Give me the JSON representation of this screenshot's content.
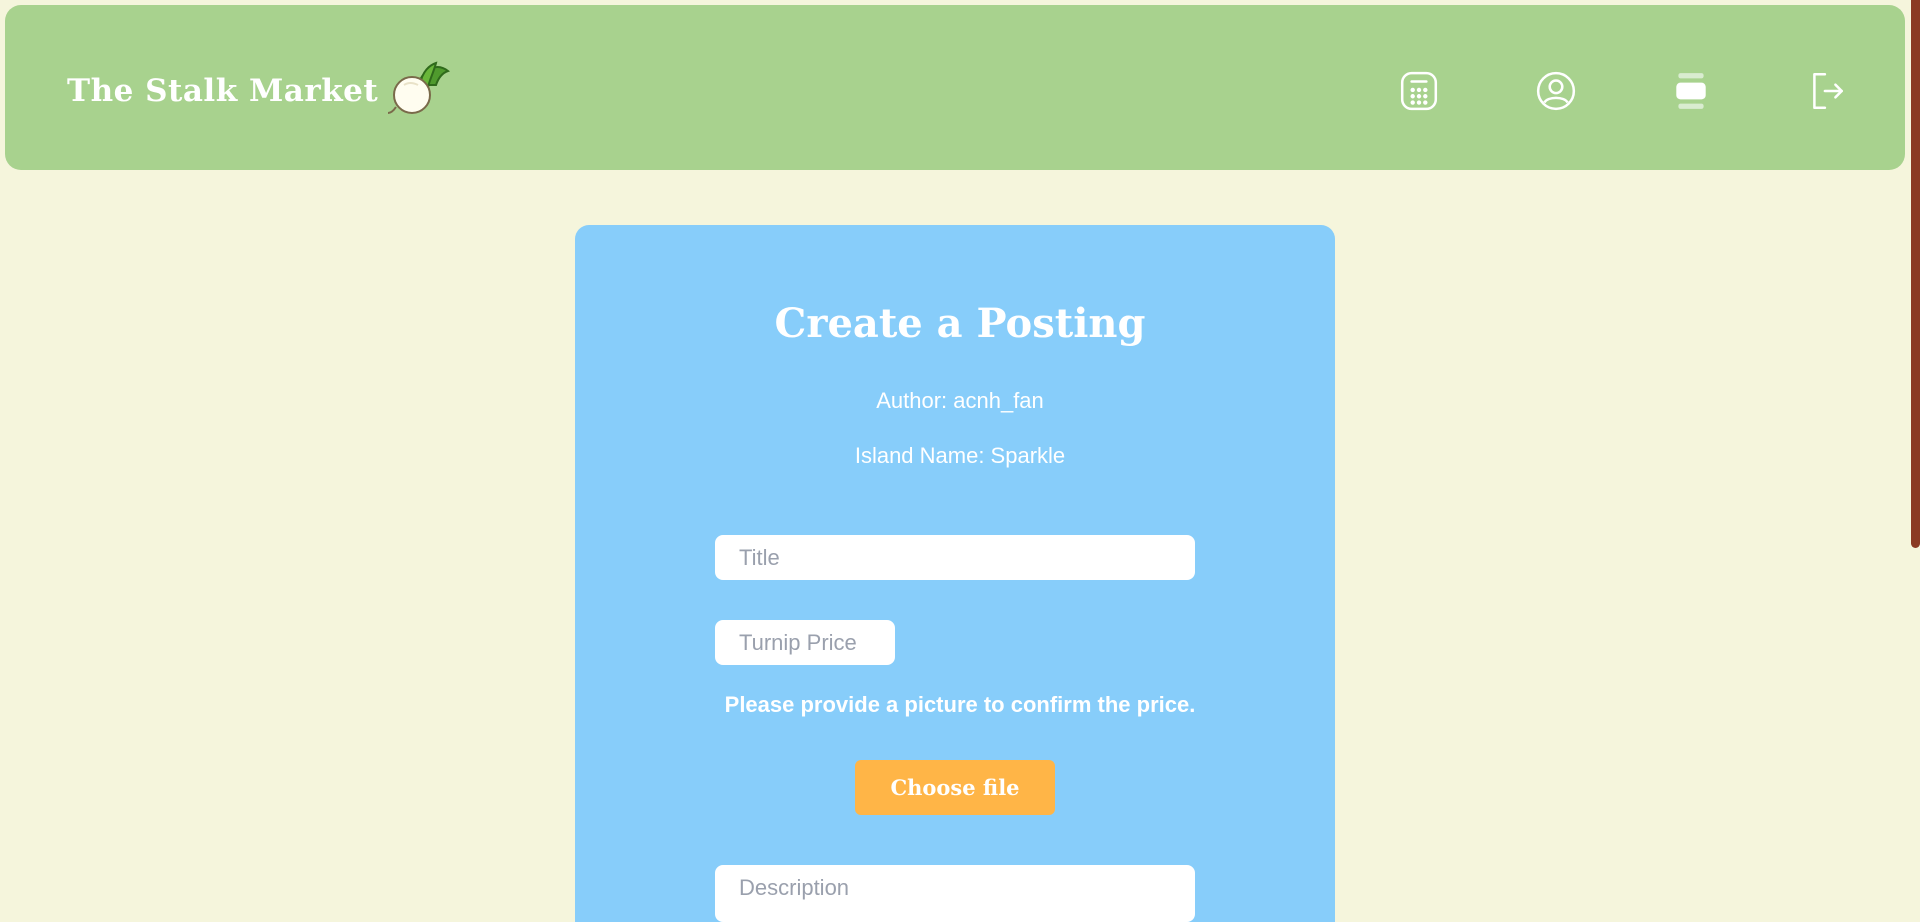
{
  "header": {
    "brand": "The Stalk Market",
    "nav": [
      {
        "icon": "calculator-icon",
        "label": ""
      },
      {
        "icon": "profile-icon",
        "label": ""
      },
      {
        "icon": "postings-icon",
        "label": ""
      },
      {
        "icon": "logout-icon",
        "label": ""
      }
    ]
  },
  "form": {
    "title": "Create a Posting",
    "author": "Author: acnh_fan",
    "island": "Island Name: Sparkle",
    "title_placeholder": "Title",
    "price_placeholder": "Turnip Price",
    "price_note": "Please provide a picture to confirm the price.",
    "file_button": "Choose file",
    "description_placeholder": "Description"
  },
  "colors": {
    "background": "#f5f5dc",
    "header": "#a8d28e",
    "card": "#87cdfa",
    "accent_button": "#ffb547",
    "scrollbar": "#8b3a23"
  }
}
